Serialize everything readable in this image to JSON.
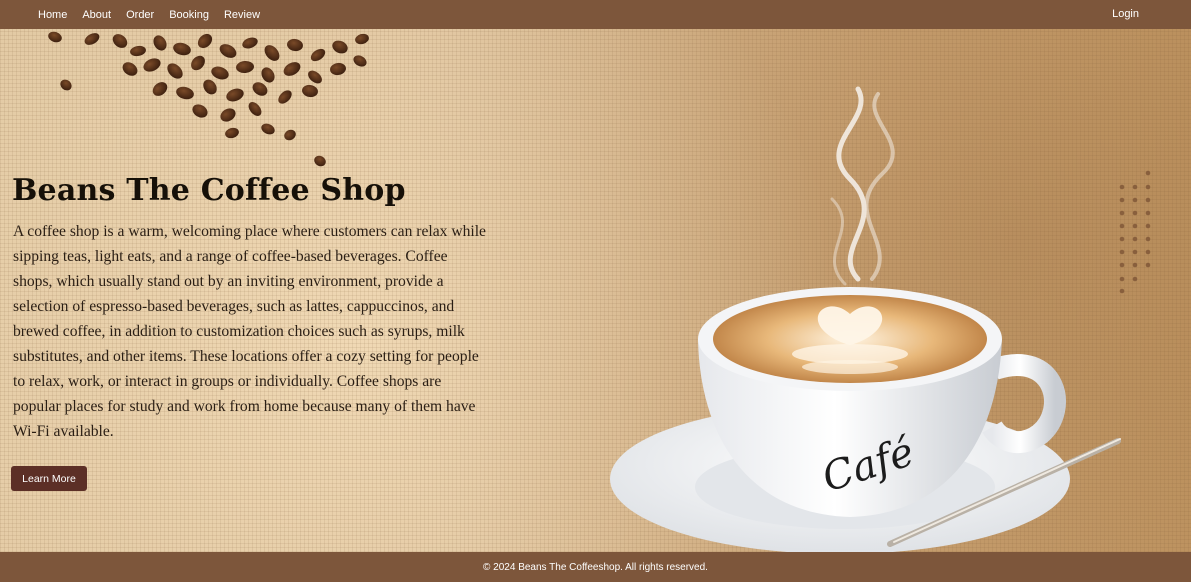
{
  "nav": {
    "links": [
      "Home",
      "About",
      "Order",
      "Booking",
      "Review"
    ],
    "login": "Login"
  },
  "hero": {
    "title": "Beans The Coffee Shop",
    "description": "A coffee shop is a warm, welcoming place where customers can relax while sipping teas, light eats, and a range of coffee-based beverages. Coffee shops, which usually stand out by an inviting environment, provide a selection of espresso-based beverages, such as lattes, cappuccinos, and brewed coffee, in addition to customization choices such as syrups, milk substitutes, and other items. These locations offer a cozy setting for people to relax, work, or interact in groups or individually. Coffee shops are popular places for study and work from home because many of them have Wi-Fi available.",
    "button_label": "Learn More",
    "cup_text": "Café"
  },
  "footer": {
    "text": "© 2024 Beans The Coffeeshop. All rights reserved."
  },
  "colors": {
    "navbar": "#7d563b",
    "button": "#5c2f26",
    "background": "#d9b990"
  }
}
